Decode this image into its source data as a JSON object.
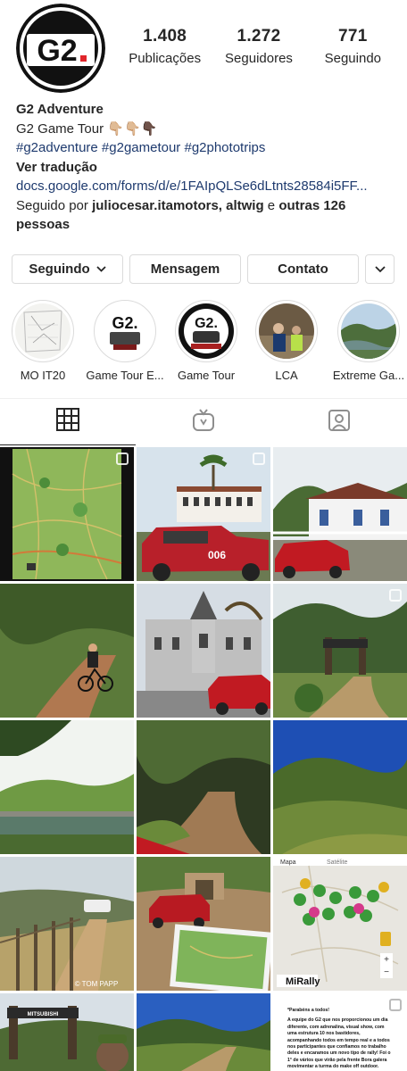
{
  "profile": {
    "logo_text": "G2",
    "stats": [
      {
        "value": "1.408",
        "label": "Publicações"
      },
      {
        "value": "1.272",
        "label": "Seguidores"
      },
      {
        "value": "771",
        "label": "Seguindo"
      }
    ],
    "name": "G2 Adventure",
    "tagline": "G2 Game Tour 👇🏼👇🏼👇🏿",
    "hashtags": "#g2adventure #g2gametour #g2phototrips",
    "see_translation": "Ver tradução",
    "link": "docs.google.com/forms/d/e/1FAIpQLSe6dLtnts28584i5FF...",
    "followed_by_prefix": "Seguido por ",
    "followed_by_users": "juliocesar.itamotors, altwig",
    "followed_by_and": " e ",
    "followed_by_others": "outras 126 pessoas"
  },
  "actions": {
    "following": "Seguindo",
    "message": "Mensagem",
    "contact": "Contato"
  },
  "highlights": [
    {
      "label": "MO IT20"
    },
    {
      "label": "Game Tour E..."
    },
    {
      "label": "Game Tour"
    },
    {
      "label": "LCA"
    },
    {
      "label": "Extreme Ga..."
    }
  ],
  "tabs": [
    {
      "icon": "grid-icon",
      "active": true
    },
    {
      "icon": "igtv-icon",
      "active": false
    },
    {
      "icon": "tagged-icon",
      "active": false
    }
  ],
  "grid_images": [
    {
      "name": "post-map-trail",
      "multi": true
    },
    {
      "name": "post-pickup-farmhouse",
      "multi": true
    },
    {
      "name": "post-red-suv-station",
      "multi": false
    },
    {
      "name": "post-cyclist-dirt-road",
      "multi": false
    },
    {
      "name": "post-castle-suv",
      "multi": false
    },
    {
      "name": "post-trail-gate",
      "multi": true
    },
    {
      "name": "post-bridge-river",
      "multi": false
    },
    {
      "name": "post-forest-trail",
      "multi": false
    },
    {
      "name": "post-green-hill",
      "multi": false
    },
    {
      "name": "post-fence-road",
      "multi": false
    },
    {
      "name": "post-pickup-map",
      "multi": false
    },
    {
      "name": "post-mirally-map",
      "multi": false
    },
    {
      "name": "post-mitsubishi-gate",
      "multi": false
    },
    {
      "name": "post-mountain-road",
      "multi": false
    },
    {
      "name": "post-text-announcement",
      "multi": true
    }
  ],
  "post_texts": {
    "map_brand": "MiRally",
    "map_tab_left": "Mapa",
    "map_tab_right": "Satélite",
    "gate_brand": "MITSUBISHI",
    "vehicle_plate": "006",
    "photo_credit": "© TOM PAPP",
    "announcement_title": "*Parabéns a todos!",
    "announcement_body": "A equipe do G2 que nos proporcionou um dia diferente, com adrenalina, visual show, com uma estrutura 10 nos bastidores, acompanhando todos em tempo real e a todos nos participantes que confiamos no trabalho deles e encaramos um novo tipo de rally! Foi o 1° de vários que virão pela frente Bora galera movimentar a turma do make off outdoor."
  },
  "colors": {
    "text": "#262626",
    "link": "#1e3a6e",
    "border": "#dbdbdb",
    "logo_red": "#e0252b"
  }
}
